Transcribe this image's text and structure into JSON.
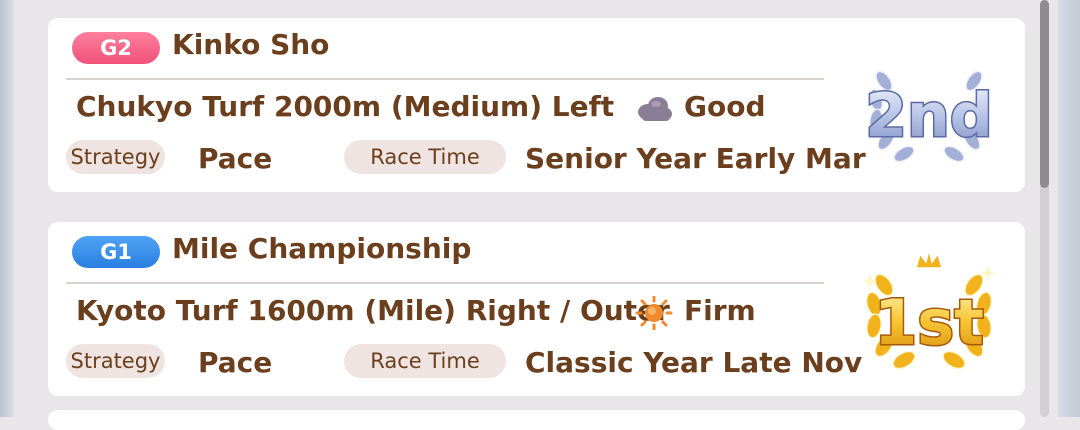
{
  "labels": {
    "strategy": "Strategy",
    "race_time": "Race Time"
  },
  "races": [
    {
      "grade": "G2",
      "name": "Kinko Sho",
      "course": "Chukyo Turf 2000m (Medium) Left",
      "weather_icon": "cloudy-icon",
      "condition": "Good",
      "strategy": "Pace",
      "race_time": "Senior Year Early Mar",
      "placement": "2nd",
      "placement_emblem": "silver-laurel"
    },
    {
      "grade": "G1",
      "name": "Mile Championship",
      "course": "Kyoto Turf 1600m (Mile) Right / Outer",
      "weather_icon": "sunny-icon",
      "condition": "Firm",
      "strategy": "Pace",
      "race_time": "Classic Year Late Nov",
      "placement": "1st",
      "placement_emblem": "gold-laurel-crown"
    }
  ],
  "colors": {
    "text": "#6b3f1d",
    "g2_badge": "#f0527a",
    "g1_badge": "#2a7fe0",
    "chip_bg": "#efe4e1",
    "silver": "#9aa9d6",
    "gold": "#f2b21c",
    "sun": "#f08a2a"
  }
}
